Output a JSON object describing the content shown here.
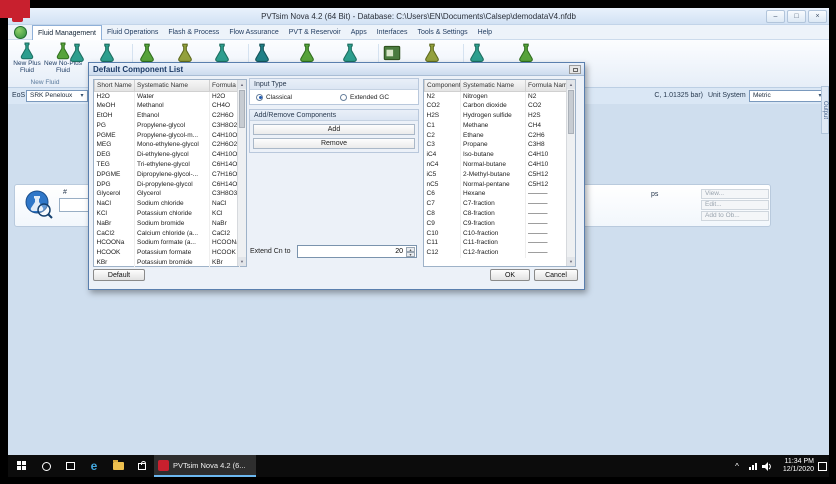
{
  "colors": {
    "accent_red": "#c8202e",
    "flask_teal": "#2d9e8e",
    "selection_blue": "#1f5bb5",
    "taskbar_black": "#0c0c0c"
  },
  "titlebar": {
    "title": "PVTsim Nova 4.2 (64 Bit)  -  Database: C:\\Users\\EN\\Documents\\Calsep\\demodataV4.nfdb",
    "minimize": "–",
    "maximize": "□",
    "close": "×"
  },
  "ribbon": {
    "tabs": [
      "Fluid Management",
      "Fluid Operations",
      "Flash & Process",
      "Flow Assurance",
      "PVT & Reservoir",
      "Apps",
      "Interfaces",
      "Tools & Settings",
      "Help"
    ],
    "active_tab": "Fluid Management",
    "buttons": [
      {
        "line1": "New Plus",
        "line2": "Fluid"
      },
      {
        "line1": "New No-Plus",
        "line2": "Fluid"
      }
    ],
    "group_label": "New Fluid"
  },
  "workspace": {
    "eos_label": "EoS",
    "eos_value": "SRK Peneloux",
    "conditions_fragment": "C, 1.01325 bar)",
    "unit_system_label": "Unit System",
    "unit_system_value": "Metric",
    "comps_fragment": "ps",
    "hash_header": "#",
    "side_tab": "Output",
    "panel_buttons": [
      "View...",
      "Edit...",
      "Add to Ob..."
    ]
  },
  "dialog": {
    "title": "Default Component List",
    "left_table": {
      "headers": [
        "Short Name",
        "Systematic Name",
        "Formula N..."
      ],
      "rows": [
        [
          "H2O",
          "Water",
          "H2O"
        ],
        [
          "MeOH",
          "Methanol",
          "CH4O"
        ],
        [
          "EtOH",
          "Ethanol",
          "C2H6O"
        ],
        [
          "PG",
          "Propylene-glycol",
          "C3H8O2"
        ],
        [
          "PGME",
          "Propylene-glycol-m...",
          "C4H10O2"
        ],
        [
          "MEG",
          "Mono-ethylene-glycol",
          "C2H6O2"
        ],
        [
          "DEG",
          "Di-ethylene-glycol",
          "C4H10O3"
        ],
        [
          "TEG",
          "Tri-ethylene-glycol",
          "C6H14O4"
        ],
        [
          "DPGME",
          "Dipropylene-glycol-...",
          "C7H16O3"
        ],
        [
          "DPG",
          "Di-propylene-glycol",
          "C6H14O3"
        ],
        [
          "Glycerol",
          "Glycerol",
          "C3H8O3"
        ],
        [
          "NaCl",
          "Sodium chloride",
          "NaCl"
        ],
        [
          "KCl",
          "Potassium chloride",
          "KCl"
        ],
        [
          "NaBr",
          "Sodium bromide",
          "NaBr"
        ],
        [
          "CaCl2",
          "Calcium chloride (a...",
          "CaCl2"
        ],
        [
          "HCOONa",
          "Sodium formate (a...",
          "HCOONa"
        ],
        [
          "HCOOK",
          "Potassium formate",
          "HCOOK"
        ],
        [
          "KBr",
          "Potassium bromide",
          "KBr"
        ]
      ]
    },
    "input_type": {
      "label": "Input Type",
      "option1": "Classical",
      "option2": "Extended GC",
      "selected": "Classical"
    },
    "add_remove": {
      "label": "Add/Remove Components",
      "add": "Add",
      "remove": "Remove"
    },
    "extend_label": "Extend Cn to",
    "extend_value": "20",
    "right_table": {
      "headers": [
        "Component...",
        "Systematic Name",
        "Formula Name"
      ],
      "rows": [
        [
          "N2",
          "Nitrogen",
          "N2"
        ],
        [
          "CO2",
          "Carbon dioxide",
          "CO2"
        ],
        [
          "H2S",
          "Hydrogen sulfide",
          "H2S"
        ],
        [
          "C1",
          "Methane",
          "CH4"
        ],
        [
          "C2",
          "Ethane",
          "C2H6"
        ],
        [
          "C3",
          "Propane",
          "C3H8"
        ],
        [
          "iC4",
          "Iso-butane",
          "C4H10"
        ],
        [
          "nC4",
          "Normal-butane",
          "C4H10"
        ],
        [
          "iC5",
          "2-Methyl-butane",
          "C5H12"
        ],
        [
          "nC5",
          "Normal-pentane",
          "C5H12"
        ],
        [
          "C6",
          "Hexane",
          "———"
        ],
        [
          "C7",
          "C7-fraction",
          "———"
        ],
        [
          "C8",
          "C8-fraction",
          "———"
        ],
        [
          "C9",
          "C9-fraction",
          "———"
        ],
        [
          "C10",
          "C10-fraction",
          "———"
        ],
        [
          "C11",
          "C11-fraction",
          "———"
        ],
        [
          "C12",
          "C12-fraction",
          "———"
        ]
      ]
    },
    "default_button": "Default",
    "ok": "OK",
    "cancel": "Cancel"
  },
  "taskbar": {
    "app_label": "PVTsim Nova 4.2 (6...",
    "tray_chevron": "^",
    "time": "11:34 PM",
    "date": "12/1/2020"
  }
}
